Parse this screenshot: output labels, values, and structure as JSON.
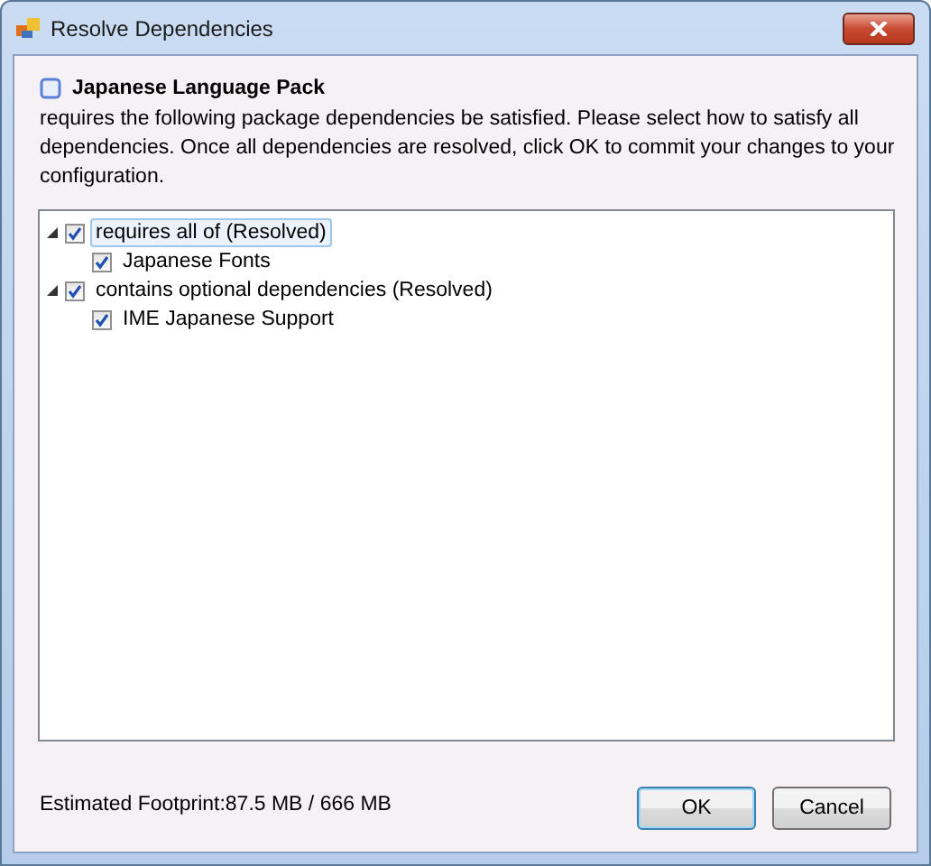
{
  "window": {
    "title": "Resolve Dependencies"
  },
  "package": {
    "name": "Japanese Language Pack",
    "description": "requires the following package dependencies be satisfied. Please select how to satisfy all dependencies. Once all dependencies are resolved, click OK to commit your changes to your configuration."
  },
  "tree": [
    {
      "label": "requires all of (Resolved)",
      "checked": true,
      "expanded": true,
      "selected": true,
      "children": [
        {
          "label": "Japanese Fonts",
          "checked": true,
          "selected": false
        }
      ]
    },
    {
      "label": "contains optional dependencies (Resolved)",
      "checked": true,
      "expanded": true,
      "selected": false,
      "children": [
        {
          "label": "IME Japanese Support",
          "checked": true,
          "selected": false
        }
      ]
    }
  ],
  "footprint": "Estimated Footprint:87.5 MB / 666 MB",
  "buttons": [
    {
      "label": "OK",
      "default": true
    },
    {
      "label": "Cancel",
      "default": false
    }
  ]
}
